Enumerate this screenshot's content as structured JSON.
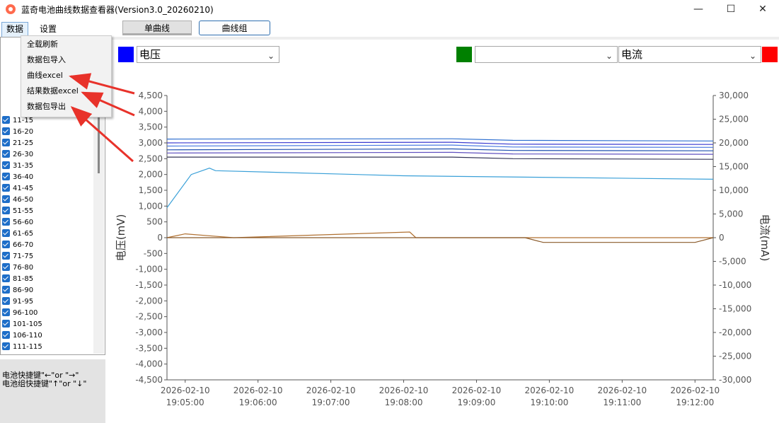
{
  "window": {
    "title": "蓝奇电池曲线数据查看器(Version3.0_20260210)",
    "minimize": "—",
    "maximize": "☐",
    "close": "✕"
  },
  "menu": {
    "data": "数据",
    "settings": "设置"
  },
  "tabs": {
    "single_curve": "单曲线",
    "curve_group": "曲线组"
  },
  "dropdown_menu": [
    "全载刷新",
    "数据包导入",
    "曲线excel",
    "结果数据excel",
    "数据包导出"
  ],
  "cell_groups": [
    "11-15",
    "16-20",
    "21-25",
    "26-30",
    "31-35",
    "36-40",
    "41-45",
    "46-50",
    "51-55",
    "56-60",
    "61-65",
    "66-70",
    "71-75",
    "76-80",
    "81-85",
    "86-90",
    "91-95",
    "96-100",
    "101-105",
    "106-110",
    "111-115"
  ],
  "hints": {
    "line1": "电池快捷键\"←\"or \"→\"",
    "line2": "电池组快捷键\"↑\"or \"↓\""
  },
  "selectors": {
    "left_value": "电压",
    "middle_value": "",
    "right_value": "电流",
    "left_color": "#0000ff",
    "middle_color": "#008000",
    "right_color": "#ff0000"
  },
  "chart_data": {
    "type": "line",
    "ylabel": "电压(mV)",
    "y2label": "电流(mA)",
    "ylim": [
      -4500,
      4500
    ],
    "y2lim": [
      -30000,
      30000
    ],
    "y_ticks": [
      "4,500",
      "4,000",
      "3,500",
      "3,000",
      "2,500",
      "2,000",
      "1,500",
      "1,000",
      "500",
      "0",
      "-500",
      "-1,000",
      "-1,500",
      "-2,000",
      "-2,500",
      "-3,000",
      "-3,500",
      "-4,000",
      "-4,500"
    ],
    "y2_ticks": [
      "30,000",
      "25,000",
      "20,000",
      "15,000",
      "10,000",
      "5,000",
      "0",
      "-5,000",
      "-10,000",
      "-15,000",
      "-20,000",
      "-25,000",
      "-30,000"
    ],
    "x_ticks": [
      {
        "date": "2026-02-10",
        "time": "19:05:00"
      },
      {
        "date": "2026-02-10",
        "time": "19:06:00"
      },
      {
        "date": "2026-02-10",
        "time": "19:07:00"
      },
      {
        "date": "2026-02-10",
        "time": "19:08:00"
      },
      {
        "date": "2026-02-10",
        "time": "19:09:00"
      },
      {
        "date": "2026-02-10",
        "time": "19:10:00"
      },
      {
        "date": "2026-02-10",
        "time": "19:11:00"
      },
      {
        "date": "2026-02-10",
        "time": "19:12:00"
      }
    ],
    "xlim": [
      "19:04:45",
      "19:12:15"
    ],
    "series": [
      {
        "axis": "left",
        "color": "#2e6fd0",
        "x": [
          "19:04:45",
          "19:08:40",
          "19:09:30",
          "19:12:15"
        ],
        "values": [
          3120,
          3130,
          3080,
          3060
        ]
      },
      {
        "axis": "left",
        "color": "#3a3ad0",
        "x": [
          "19:04:45",
          "19:08:40",
          "19:09:30",
          "19:12:15"
        ],
        "values": [
          3000,
          3020,
          2960,
          2950
        ]
      },
      {
        "axis": "left",
        "color": "#4a7ae0",
        "x": [
          "19:04:45",
          "19:08:40",
          "19:09:30",
          "19:12:15"
        ],
        "values": [
          2900,
          2930,
          2870,
          2860
        ]
      },
      {
        "axis": "left",
        "color": "#2050b0",
        "x": [
          "19:04:45",
          "19:08:40",
          "19:09:30",
          "19:12:15"
        ],
        "values": [
          2780,
          2810,
          2760,
          2750
        ]
      },
      {
        "axis": "left",
        "color": "#6050c0",
        "x": [
          "19:04:45",
          "19:08:40",
          "19:09:30",
          "19:12:15"
        ],
        "values": [
          2680,
          2700,
          2650,
          2640
        ]
      },
      {
        "axis": "left",
        "color": "#333355",
        "x": [
          "19:04:45",
          "19:08:40",
          "19:09:30",
          "19:12:15"
        ],
        "values": [
          2550,
          2550,
          2500,
          2480
        ]
      },
      {
        "axis": "left",
        "color": "#3aa0d8",
        "x": [
          "19:04:45",
          "19:05:05",
          "19:05:20",
          "19:05:25",
          "19:08:00",
          "19:12:15"
        ],
        "values": [
          950,
          2000,
          2200,
          2120,
          1960,
          1850
        ]
      },
      {
        "axis": "right",
        "color": "#b07030",
        "x": [
          "19:04:45",
          "19:05:00",
          "19:05:30",
          "19:05:40",
          "19:08:05",
          "19:08:10",
          "19:12:15"
        ],
        "values": [
          0,
          800,
          200,
          0,
          1200,
          0,
          0
        ]
      },
      {
        "axis": "right",
        "color": "#8a5a2a",
        "x": [
          "19:04:45",
          "19:09:40",
          "19:09:55",
          "19:12:00",
          "19:12:15"
        ],
        "values": [
          0,
          0,
          -1000,
          -1000,
          0
        ]
      }
    ]
  }
}
